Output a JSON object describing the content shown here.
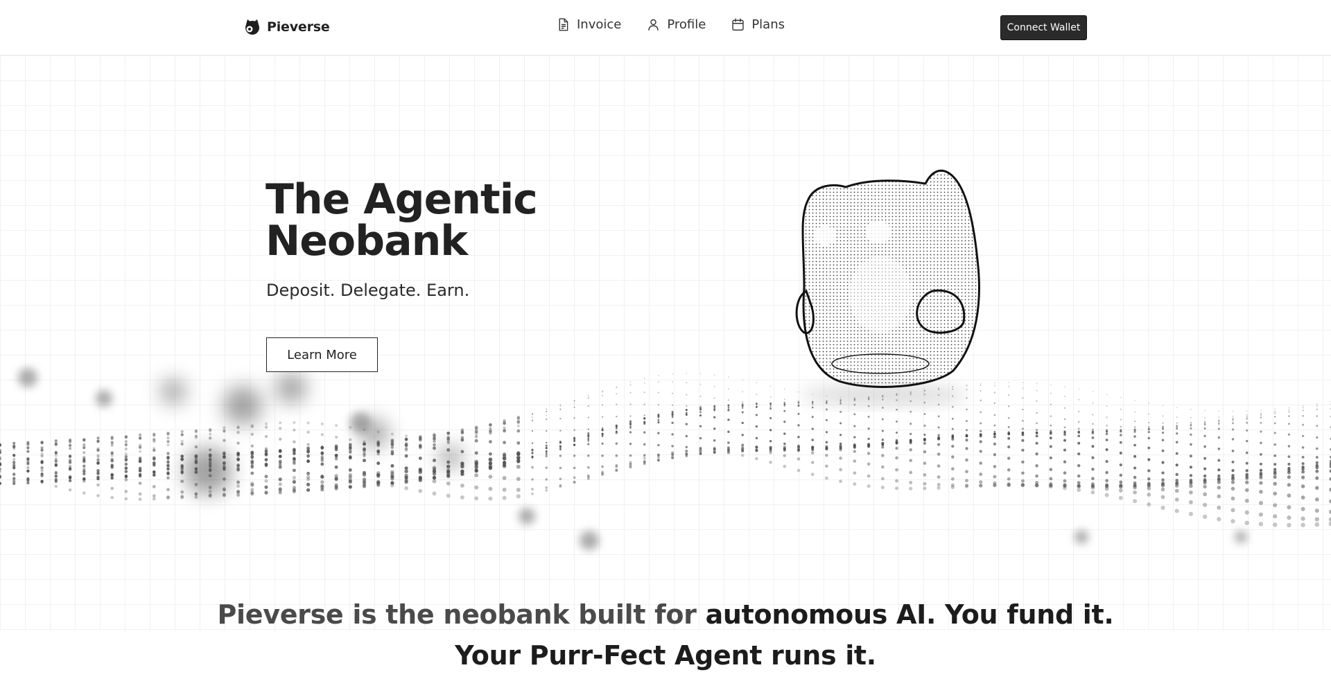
{
  "header": {
    "brand": "Pieverse",
    "nav": [
      {
        "label": "Invoice",
        "icon": "document-icon"
      },
      {
        "label": "Profile",
        "icon": "user-icon"
      },
      {
        "label": "Plans",
        "icon": "calendar-icon"
      }
    ],
    "connect_wallet": "Connect Wallet"
  },
  "hero": {
    "title": "The Agentic Neobank",
    "subtitle": "Deposit. Delegate. Earn.",
    "cta": "Learn More"
  },
  "tagline": {
    "muted": "Pieverse is the neobank built for",
    "strong": "autonomous AI. You fund it. Your Purr-Fect Agent runs it."
  },
  "colors": {
    "button_dark": "#2b2b2b",
    "text_primary": "#222222",
    "text_muted": "#4a4a4a",
    "grid_line": "#f1f1f1"
  }
}
